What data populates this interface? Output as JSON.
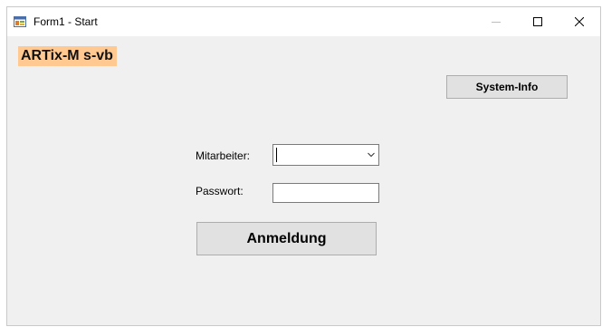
{
  "window": {
    "title": "Form1 - Start",
    "controls": {
      "minimize_icon": "minimize-icon",
      "maximize_icon": "maximize-icon",
      "close_icon": "close-icon"
    }
  },
  "form": {
    "brand_label": "ARTix-M s-vb",
    "system_info_button": "System-Info",
    "employee_label": "Mitarbeiter:",
    "employee_value": "",
    "password_label": "Passwort:",
    "password_value": "",
    "login_button": "Anmeldung"
  },
  "colors": {
    "brand_background": "#ffc991",
    "client_background": "#f0f0f0",
    "button_background": "#e1e1e1",
    "button_border": "#adadad"
  }
}
